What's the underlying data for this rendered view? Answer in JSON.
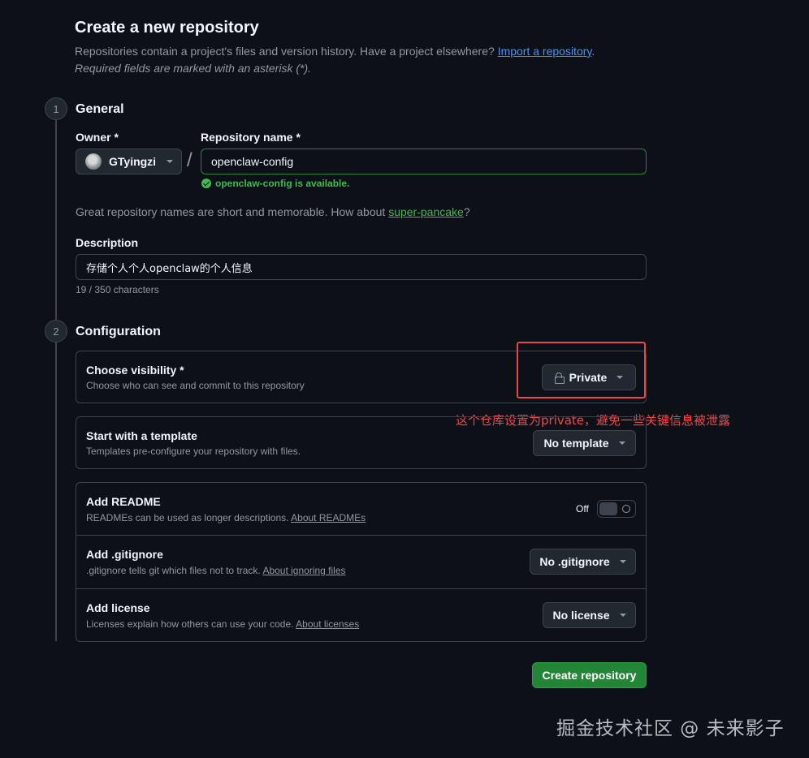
{
  "header": {
    "title": "Create a new repository",
    "intro_text": "Repositories contain a project's files and version history. Have a project elsewhere?",
    "import_link": "Import a repository",
    "intro_end": ".",
    "required_note": "Required fields are marked with an asterisk (*)."
  },
  "general": {
    "step": "1",
    "title": "General",
    "owner_label": "Owner *",
    "owner_value": "GTyingzi",
    "repo_label": "Repository name *",
    "repo_value": "openclaw-config",
    "availability": "openclaw-config is available.",
    "hint_text": "Great repository names are short and memorable. How about",
    "hint_suggestion": "super-pancake",
    "hint_end": "?",
    "description_label": "Description",
    "description_value": "存储个人个人openclaw的个人信息",
    "char_count": "19 / 350 characters"
  },
  "configuration": {
    "step": "2",
    "title": "Configuration",
    "visibility": {
      "title": "Choose visibility *",
      "desc": "Choose who can see and commit to this repository",
      "value": "Private"
    },
    "template": {
      "title": "Start with a template",
      "desc": "Templates pre-configure your repository with files.",
      "value": "No template"
    },
    "readme": {
      "title": "Add README",
      "desc": "READMEs can be used as longer descriptions.",
      "link": "About READMEs",
      "toggle_label": "Off"
    },
    "gitignore": {
      "title": "Add .gitignore",
      "desc": ".gitignore tells git which files not to track.",
      "link": "About ignoring files",
      "value": "No .gitignore"
    },
    "license": {
      "title": "Add license",
      "desc": "Licenses explain how others can use your code.",
      "link": "About licenses",
      "value": "No license"
    }
  },
  "create_button": "Create repository",
  "annotation": "这个仓库设置为private，避免一些关键信息被泄露",
  "watermark": "掘金技术社区 @ 未来影子",
  "colors": {
    "background": "#0d1117",
    "accent_green": "#238636",
    "link_blue": "#4493f8",
    "annotation_red": "#e5474b"
  },
  "icons": [
    "check-circle-icon",
    "lock-icon",
    "chevron-down-icon",
    "avatar",
    "toggle-off-icon"
  ]
}
